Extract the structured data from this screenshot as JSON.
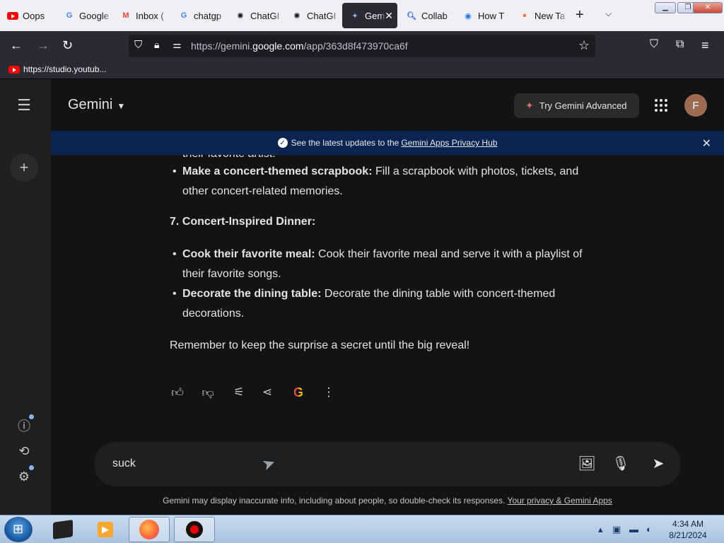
{
  "browser": {
    "tabs": [
      {
        "label": "Oops",
        "favicon": "youtube-favicon"
      },
      {
        "label": "Google",
        "favicon": "google-favicon"
      },
      {
        "label": "Inbox (",
        "favicon": "gmail-favicon"
      },
      {
        "label": "chatgp",
        "favicon": "google-favicon"
      },
      {
        "label": "ChatGI",
        "favicon": "openai-favicon"
      },
      {
        "label": "ChatGI",
        "favicon": "openai-favicon"
      },
      {
        "label": "Gem",
        "favicon": "gemini-favicon",
        "active": true
      },
      {
        "label": "Collab",
        "favicon": "search-favicon"
      },
      {
        "label": "How T",
        "favicon": "chat-favicon"
      },
      {
        "label": "New Ta",
        "favicon": "firefox-favicon"
      }
    ],
    "url_prefix": "https://gemini.",
    "url_domain": "google.com",
    "url_path": "/app/363d8f473970ca6f",
    "bookmark": "https://studio.youtub..."
  },
  "gemini": {
    "title": "Gemini",
    "try_advanced": "Try Gemini Advanced",
    "avatar_letter": "F",
    "banner_text": "See the latest updates to the",
    "banner_link": "Gemini Apps Privacy Hub",
    "cut_line": "their favorite artist.",
    "list_a": [
      {
        "bold": "Make a concert-themed scrapbook:",
        "text": " Fill a scrapbook with photos, tickets, and other concert-related memories."
      }
    ],
    "heading_7": "7. Concert-Inspired Dinner:",
    "list_b": [
      {
        "bold": "Cook their favorite meal:",
        "text": " Cook their favorite meal and serve it with a playlist of their favorite songs."
      },
      {
        "bold": "Decorate the dining table:",
        "text": " Decorate the dining table with concert-themed decorations."
      }
    ],
    "closing": "Remember to keep the surprise a secret until the big reveal!",
    "input_value": "suck",
    "footnote": "Gemini may display inaccurate info, including about people, so double-check its responses.",
    "footnote_link": "Your privacy & Gemini Apps"
  },
  "taskbar": {
    "time": "4:34 AM",
    "date": "8/21/2024"
  },
  "colors": {
    "background": "#131314",
    "banner": "#0b2450",
    "input": "#1e1f20",
    "accent_spark": "#e46962"
  }
}
